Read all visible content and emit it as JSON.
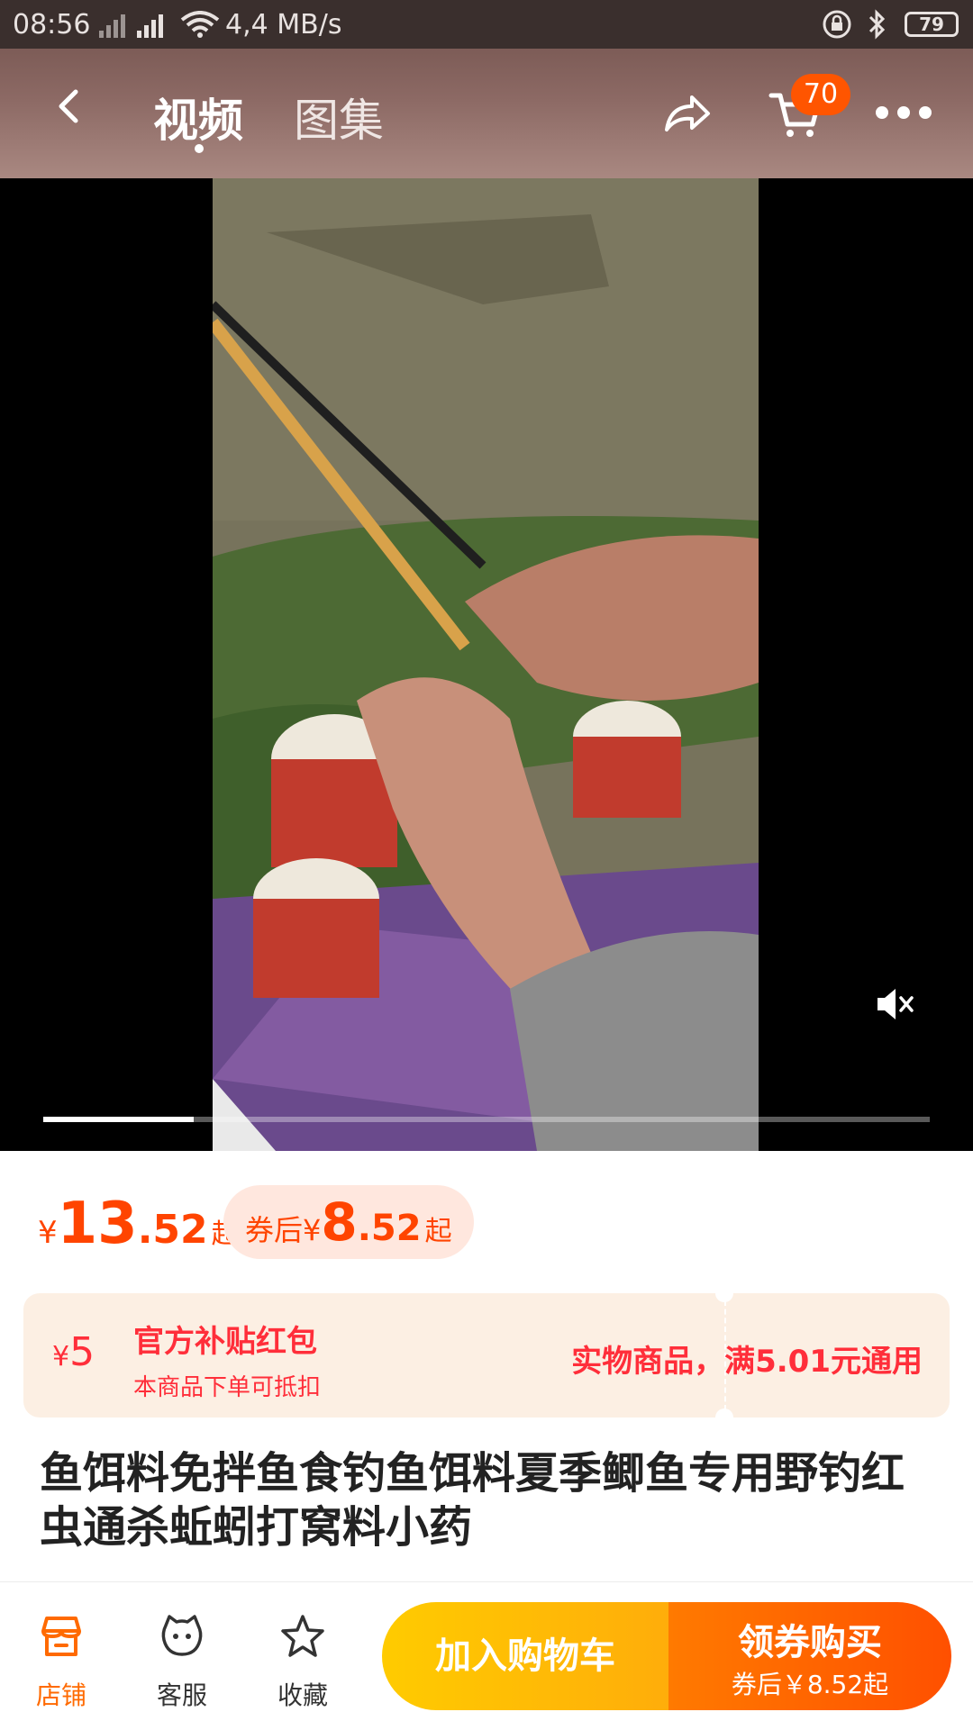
{
  "status_bar": {
    "time": "08:56",
    "net_speed": "4,4 MB/s",
    "battery": "79"
  },
  "nav": {
    "tabs": [
      {
        "label": "视频",
        "active": true
      },
      {
        "label": "图集",
        "active": false
      }
    ],
    "cart_count": "70",
    "icons": [
      "back-icon",
      "share-icon",
      "cart-icon",
      "more-icon"
    ]
  },
  "video": {
    "muted": true,
    "progress": 0.17
  },
  "price": {
    "symbol": "¥",
    "integer": "13",
    "decimal": ".52",
    "suffix": "起"
  },
  "coupon_price": {
    "label": "券后¥",
    "integer": "8",
    "decimal": ".52",
    "suffix": "起"
  },
  "subsidy": {
    "symbol": "¥",
    "amount": "5",
    "title": "官方补贴红包",
    "desc": "本商品下单可抵扣",
    "condition": "实物商品，满5.01元通用"
  },
  "product_title": "鱼饵料免拌鱼食钓鱼饵料夏季鲫鱼专用野钓红虫通杀蚯蚓打窝料小药",
  "bottom_bar": {
    "store": "店铺",
    "service": "客服",
    "favorite": "收藏",
    "add_to_cart": "加入购物车",
    "buy_title": "领券购买",
    "buy_sub": "券后￥8.52起"
  },
  "colors": {
    "accent": "#ff5000",
    "price": "#ff4400",
    "subsidy_red": "#ff2e3a",
    "cart_yellow": "#ffcb00"
  }
}
